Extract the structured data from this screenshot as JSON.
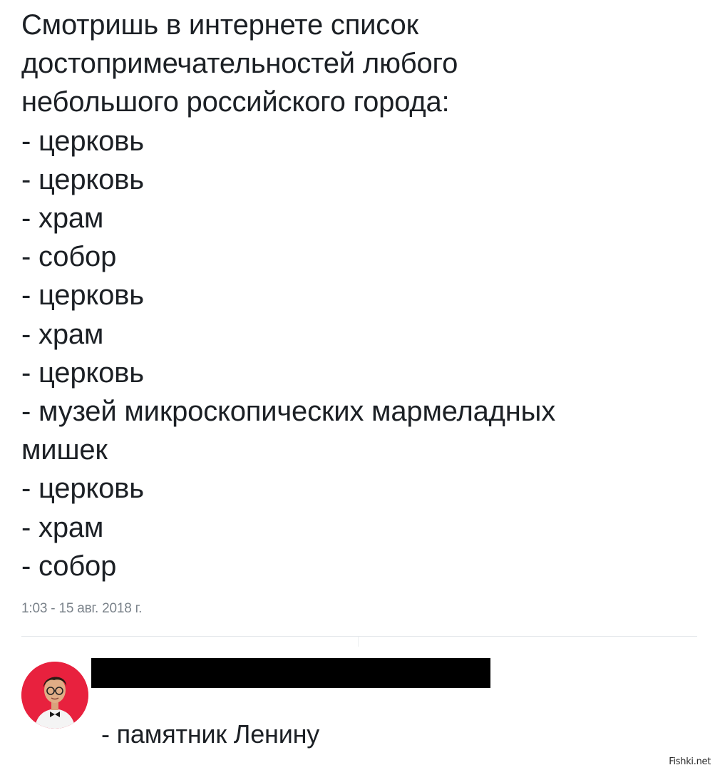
{
  "tweet": {
    "lines": [
      "Смотришь в интернете список",
      "достопримечательностей любого",
      "небольшого российского города:",
      "- церковь",
      "- церковь",
      "- храм",
      "- собор",
      "- церковь",
      "- храм",
      "- церковь",
      "- музей микроскопических мармеладных",
      "мишек",
      "- церковь",
      "- храм",
      "- собор"
    ],
    "timestamp": "1:03 - 15 авг. 2018 г."
  },
  "reply": {
    "text": "- памятник Ленину",
    "avatar_color": "#e8213e"
  },
  "watermark": "Fishki.net"
}
